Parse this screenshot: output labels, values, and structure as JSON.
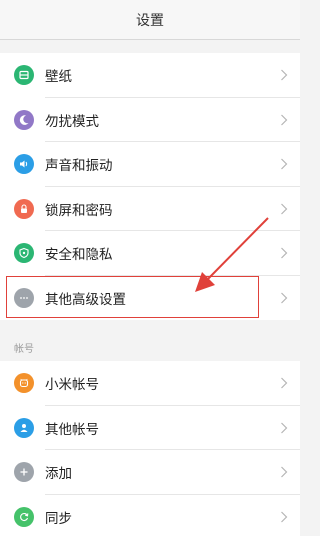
{
  "header": {
    "title": "设置"
  },
  "group1": [
    {
      "label": "壁纸",
      "icon": "wallpaper-icon",
      "color": "#2bb673"
    },
    {
      "label": "勿扰模式",
      "icon": "moon-icon",
      "color": "#9178c7"
    },
    {
      "label": "声音和振动",
      "icon": "speaker-icon",
      "color": "#2b9ee6"
    },
    {
      "label": "锁屏和密码",
      "icon": "lock-icon",
      "color": "#f06a51"
    },
    {
      "label": "安全和隐私",
      "icon": "shield-icon",
      "color": "#2bb673"
    },
    {
      "label": "其他高级设置",
      "icon": "more-dots-icon",
      "color": "#9ea4ab"
    }
  ],
  "accounts_section": {
    "header": "帐号"
  },
  "group2": [
    {
      "label": "小米帐号",
      "icon": "mi-account-icon",
      "color": "#f3912b"
    },
    {
      "label": "其他帐号",
      "icon": "person-icon",
      "color": "#2b9ee6"
    },
    {
      "label": "添加",
      "icon": "plus-icon",
      "color": "#9ea4ab"
    },
    {
      "label": "同步",
      "icon": "sync-icon",
      "color": "#45c26a"
    }
  ],
  "annotation_color": "#e0413a"
}
